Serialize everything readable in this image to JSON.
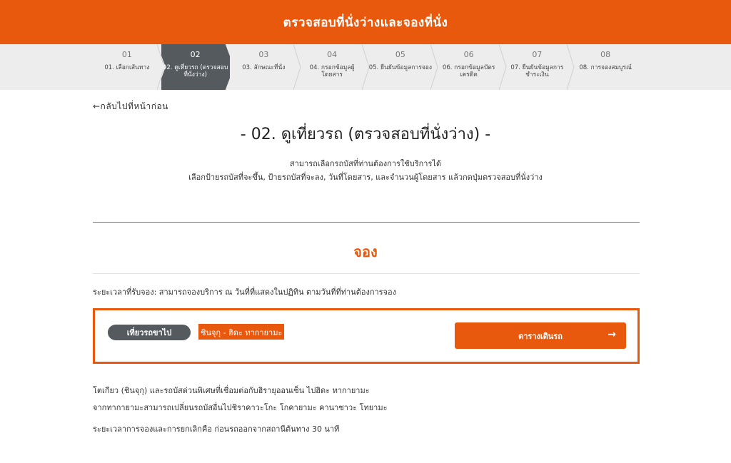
{
  "header": {
    "title": "ตรวจสอบที่นั่งว่างและจองที่นั่ง"
  },
  "steps": [
    {
      "num": "01",
      "label": "01. เลือกเส้นทาง"
    },
    {
      "num": "02",
      "label": "02. ดูเที่ยวรถ (ตรวจสอบที่นั่งว่าง)"
    },
    {
      "num": "03",
      "label": "03. ลักษณะที่นั่ง"
    },
    {
      "num": "04",
      "label": "04. กรอกข้อมูลผู้โดยสาร"
    },
    {
      "num": "05",
      "label": "05. ยืนยันข้อมูลการจอง"
    },
    {
      "num": "06",
      "label": "06. กรอกข้อมูลบัตรเครดิต"
    },
    {
      "num": "07",
      "label": "07. ยืนยันข้อมูลการชำระเงิน"
    },
    {
      "num": "08",
      "label": "08. การจองสมบูรณ์"
    }
  ],
  "back_link": "←กลับไปที่หน้าก่อน",
  "page_title": "-   02. ดูเที่ยวรถ (ตรวจสอบที่นั่งว่าง)   -",
  "description": {
    "line1": "สามารถเลือกรถบัสที่ท่านต้องการใช้บริการได้",
    "line2": "เลือกป้ายรถบัสที่จะขึ้น, ป้ายรถบัสที่จะลง, วันที่โดยสาร, และจำนวนผู้โดยสาร แล้วกดปุ่มตรวจสอบที่นั่งว่าง"
  },
  "section_title": "จอง",
  "booking_period": "ระยะเวลาที่รับจอง: สามารถจองบริการ ณ วันที่ที่แสดงในปฏิทิน ตามวันที่ที่ท่านต้องการจอง",
  "booking": {
    "direction_label": "เที่ยวรถขาไป",
    "route": "ชินจุกุ - ฮิดะ ทากายามะ",
    "timetable_label": "ตารางเดินรถ",
    "arrow": "→"
  },
  "notes": {
    "line1": "โตเกียว (ชินจุกุ) และรถบัสด่วนพิเศษที่เชื่อมต่อกับฮิรายุออนเซ็น ไปฮิดะ ทากายามะ",
    "line2": "จากทากายามะสามารถเปลี่ยนรถบัสอื่นไปชิราคาวะโกะ โกคายามะ คานาซาวะ โทยามะ",
    "line3": "ระยะเวลาการจองและการยกเลิกคือ ก่อนรถออกจากสถานีต้นทาง 30 นาที"
  },
  "colors": {
    "accent": "#e8580d",
    "active_step": "#555a5f",
    "step_bar": "#ededed"
  }
}
